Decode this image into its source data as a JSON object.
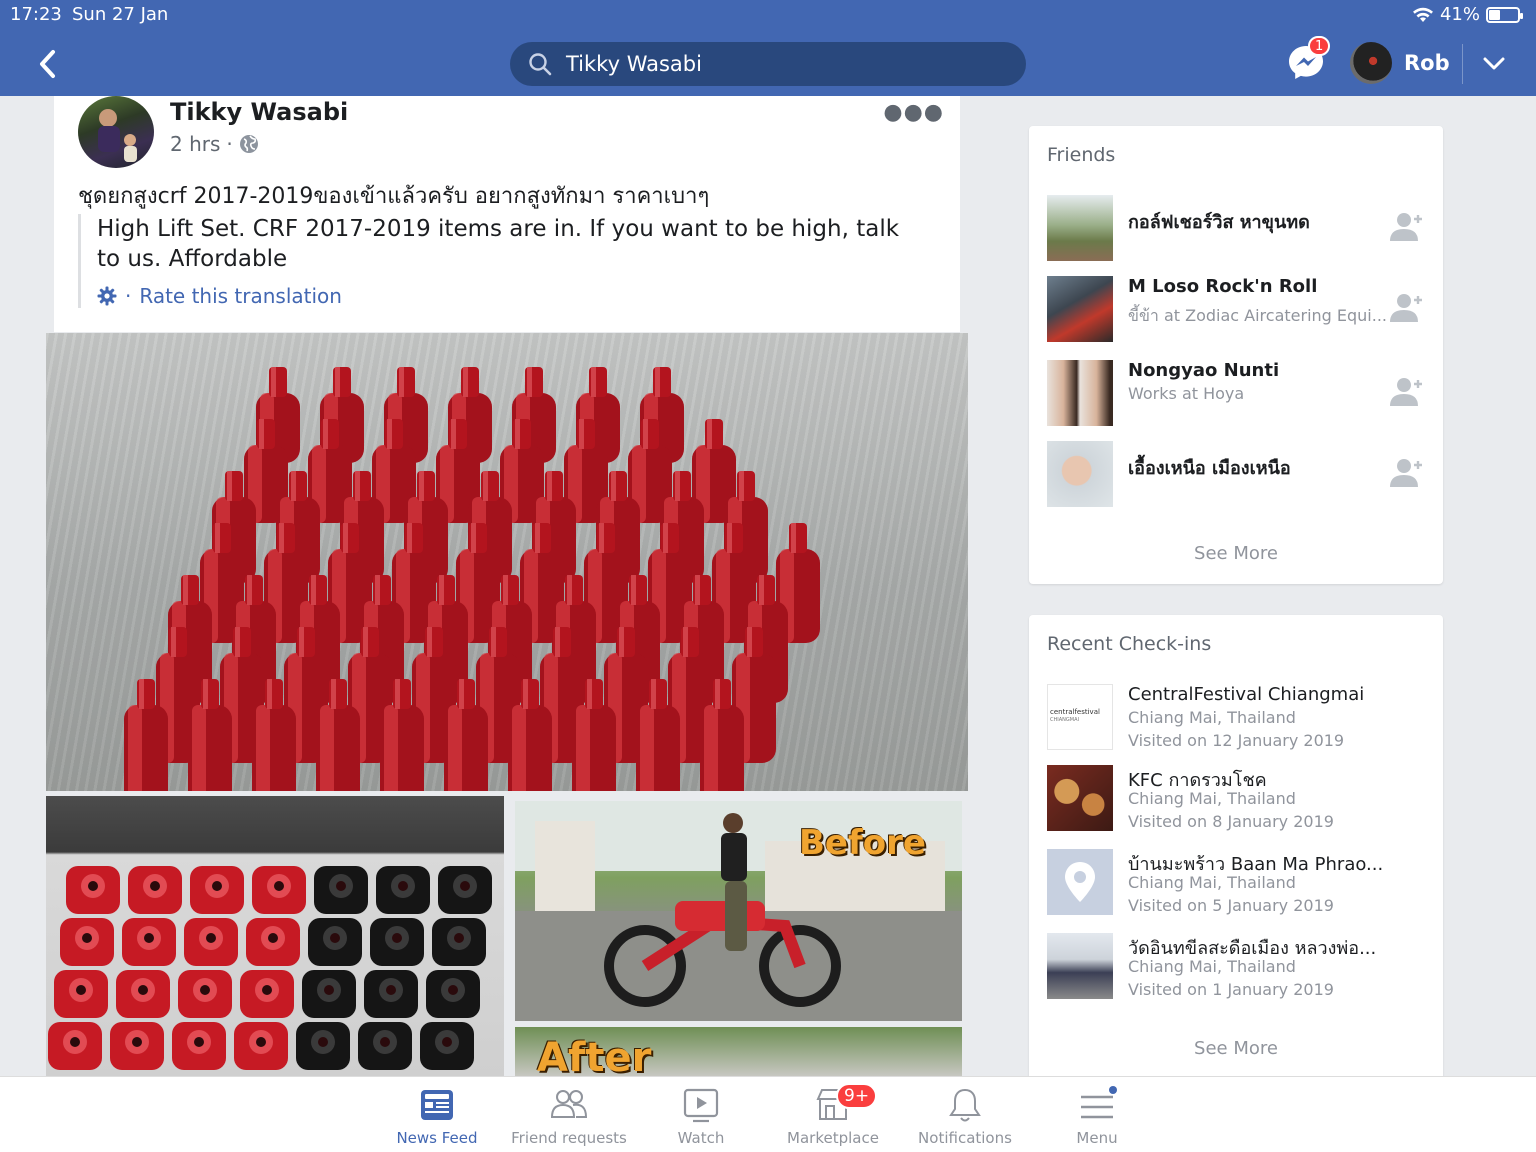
{
  "status_bar": {
    "time": "17:23",
    "date": "Sun 27 Jan",
    "battery_text": "41%",
    "battery_level": 0.41
  },
  "header": {
    "search_value": "Tikky Wasabi",
    "messenger_badge": "1",
    "profile_name": "Rob",
    "brand_color": "#4267b2"
  },
  "post": {
    "author": "Tikky Wasabi",
    "time": "2 hrs",
    "separator": "·",
    "text": "ชุดยกสูงcrf 2017-2019ของเข้าแล้วครับ อยากสูงทักมา ราคาเบาๆ",
    "translation": "High Lift Set. CRF 2017-2019 items are in. If you want to be high, talk to us. Affordable",
    "rate_translation": "Rate this translation",
    "photo_labels": {
      "before": "Before",
      "after": "After"
    }
  },
  "friends": {
    "title": "Friends",
    "items": [
      {
        "name": "กอล์ฟเชอร์วิส หาขุนทด",
        "sub": ""
      },
      {
        "name": "M Loso Rock'n Roll",
        "sub": "ขี้ข้า at Zodiac Aircatering Equi..."
      },
      {
        "name": "Nongyao Nunti",
        "sub": "Works at Hoya"
      },
      {
        "name": "เอื้องเหนือ เมืองเหนือ",
        "sub": ""
      }
    ],
    "see_more": "See More"
  },
  "checkins": {
    "title": "Recent Check-ins",
    "items": [
      {
        "name": "CentralFestival Chiangmai",
        "location": "Chiang Mai, Thailand",
        "visited": "Visited on 12 January 2019",
        "logo_text": "centralfestival",
        "logo_sub": "CHIANGMAI"
      },
      {
        "name": "KFC กาดรวมโชค",
        "location": "Chiang Mai, Thailand",
        "visited": "Visited on 8 January 2019"
      },
      {
        "name": "บ้านมะพร้าว Baan Ma Phrao...",
        "location": "Chiang Mai, Thailand",
        "visited": "Visited on 5 January 2019"
      },
      {
        "name": "วัดอินทขีลสะดือเมือง หลวงพ่อ...",
        "location": "Chiang Mai, Thailand",
        "visited": "Visited on 1 January 2019"
      }
    ],
    "see_more": "See More"
  },
  "tabbar": {
    "tabs": [
      {
        "label": "News Feed",
        "icon": "news-feed-icon",
        "active": true
      },
      {
        "label": "Friend requests",
        "icon": "friends-icon",
        "active": false
      },
      {
        "label": "Watch",
        "icon": "watch-icon",
        "active": false
      },
      {
        "label": "Marketplace",
        "icon": "marketplace-icon",
        "active": false,
        "badge": "9+"
      },
      {
        "label": "Notifications",
        "icon": "bell-icon",
        "active": false
      },
      {
        "label": "Menu",
        "icon": "menu-icon",
        "active": false
      }
    ]
  }
}
